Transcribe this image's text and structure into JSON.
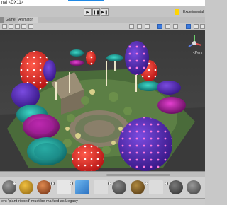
{
  "window": {
    "title": "nal <DX11>"
  },
  "toolbar": {
    "play": "▶",
    "pause": "❚❚",
    "step": "▶❚",
    "experimental_badge": "!",
    "experimental_label": "Experimental"
  },
  "tabs": {
    "game": "Game",
    "animator": "Animator"
  },
  "viewport": {
    "gizmo_label": "< Persp",
    "persp_short": "<Pers"
  },
  "status": {
    "message": "ent 'plant-ripped' must be marked as Legacy"
  },
  "colors": {
    "selection": "#3d7be0",
    "warning": "#ffd400",
    "ground": "#4a6b3a",
    "stone": "#8a7f6a"
  }
}
